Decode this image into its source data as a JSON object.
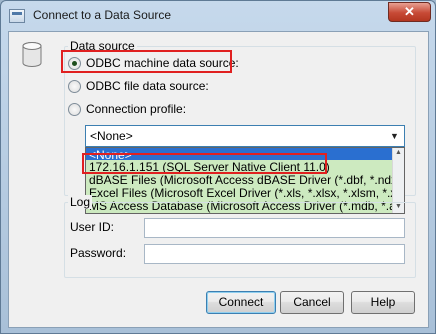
{
  "window": {
    "title": "Connect to a Data Source",
    "close_glyph": "✕"
  },
  "data_source": {
    "group_label": "Data source",
    "odbc_machine": "ODBC machine data source:",
    "odbc_file": "ODBC file data source:",
    "connection_profile": "Connection profile:",
    "selected": "odbc_machine"
  },
  "combo": {
    "value": "<None>"
  },
  "dropdown": {
    "items": [
      "<None>",
      "172.16.1.151 (SQL Server Native Client 11.0)",
      "dBASE Files (Microsoft Access dBASE Driver (*.dbf, *.ndx, *.mdx))",
      "Excel Files (Microsoft Excel Driver (*.xls, *.xlsx, *.xlsm, *.xlsb))",
      "MS Access Database (Microsoft Access Driver (*.mdb, *.accdb))"
    ]
  },
  "login": {
    "group_label": "Log",
    "user_id_label": "User ID:",
    "password_label": "Password:"
  },
  "buttons": {
    "connect": "Connect",
    "cancel": "Cancel",
    "help": "Help"
  },
  "colors": {
    "highlight": "#e02020",
    "selection": "#cdeac0",
    "focus_border": "#3c7fb1"
  },
  "icons": {
    "app": "data-source-icon",
    "database": "database-cylinder-icon",
    "close": "close-icon"
  }
}
